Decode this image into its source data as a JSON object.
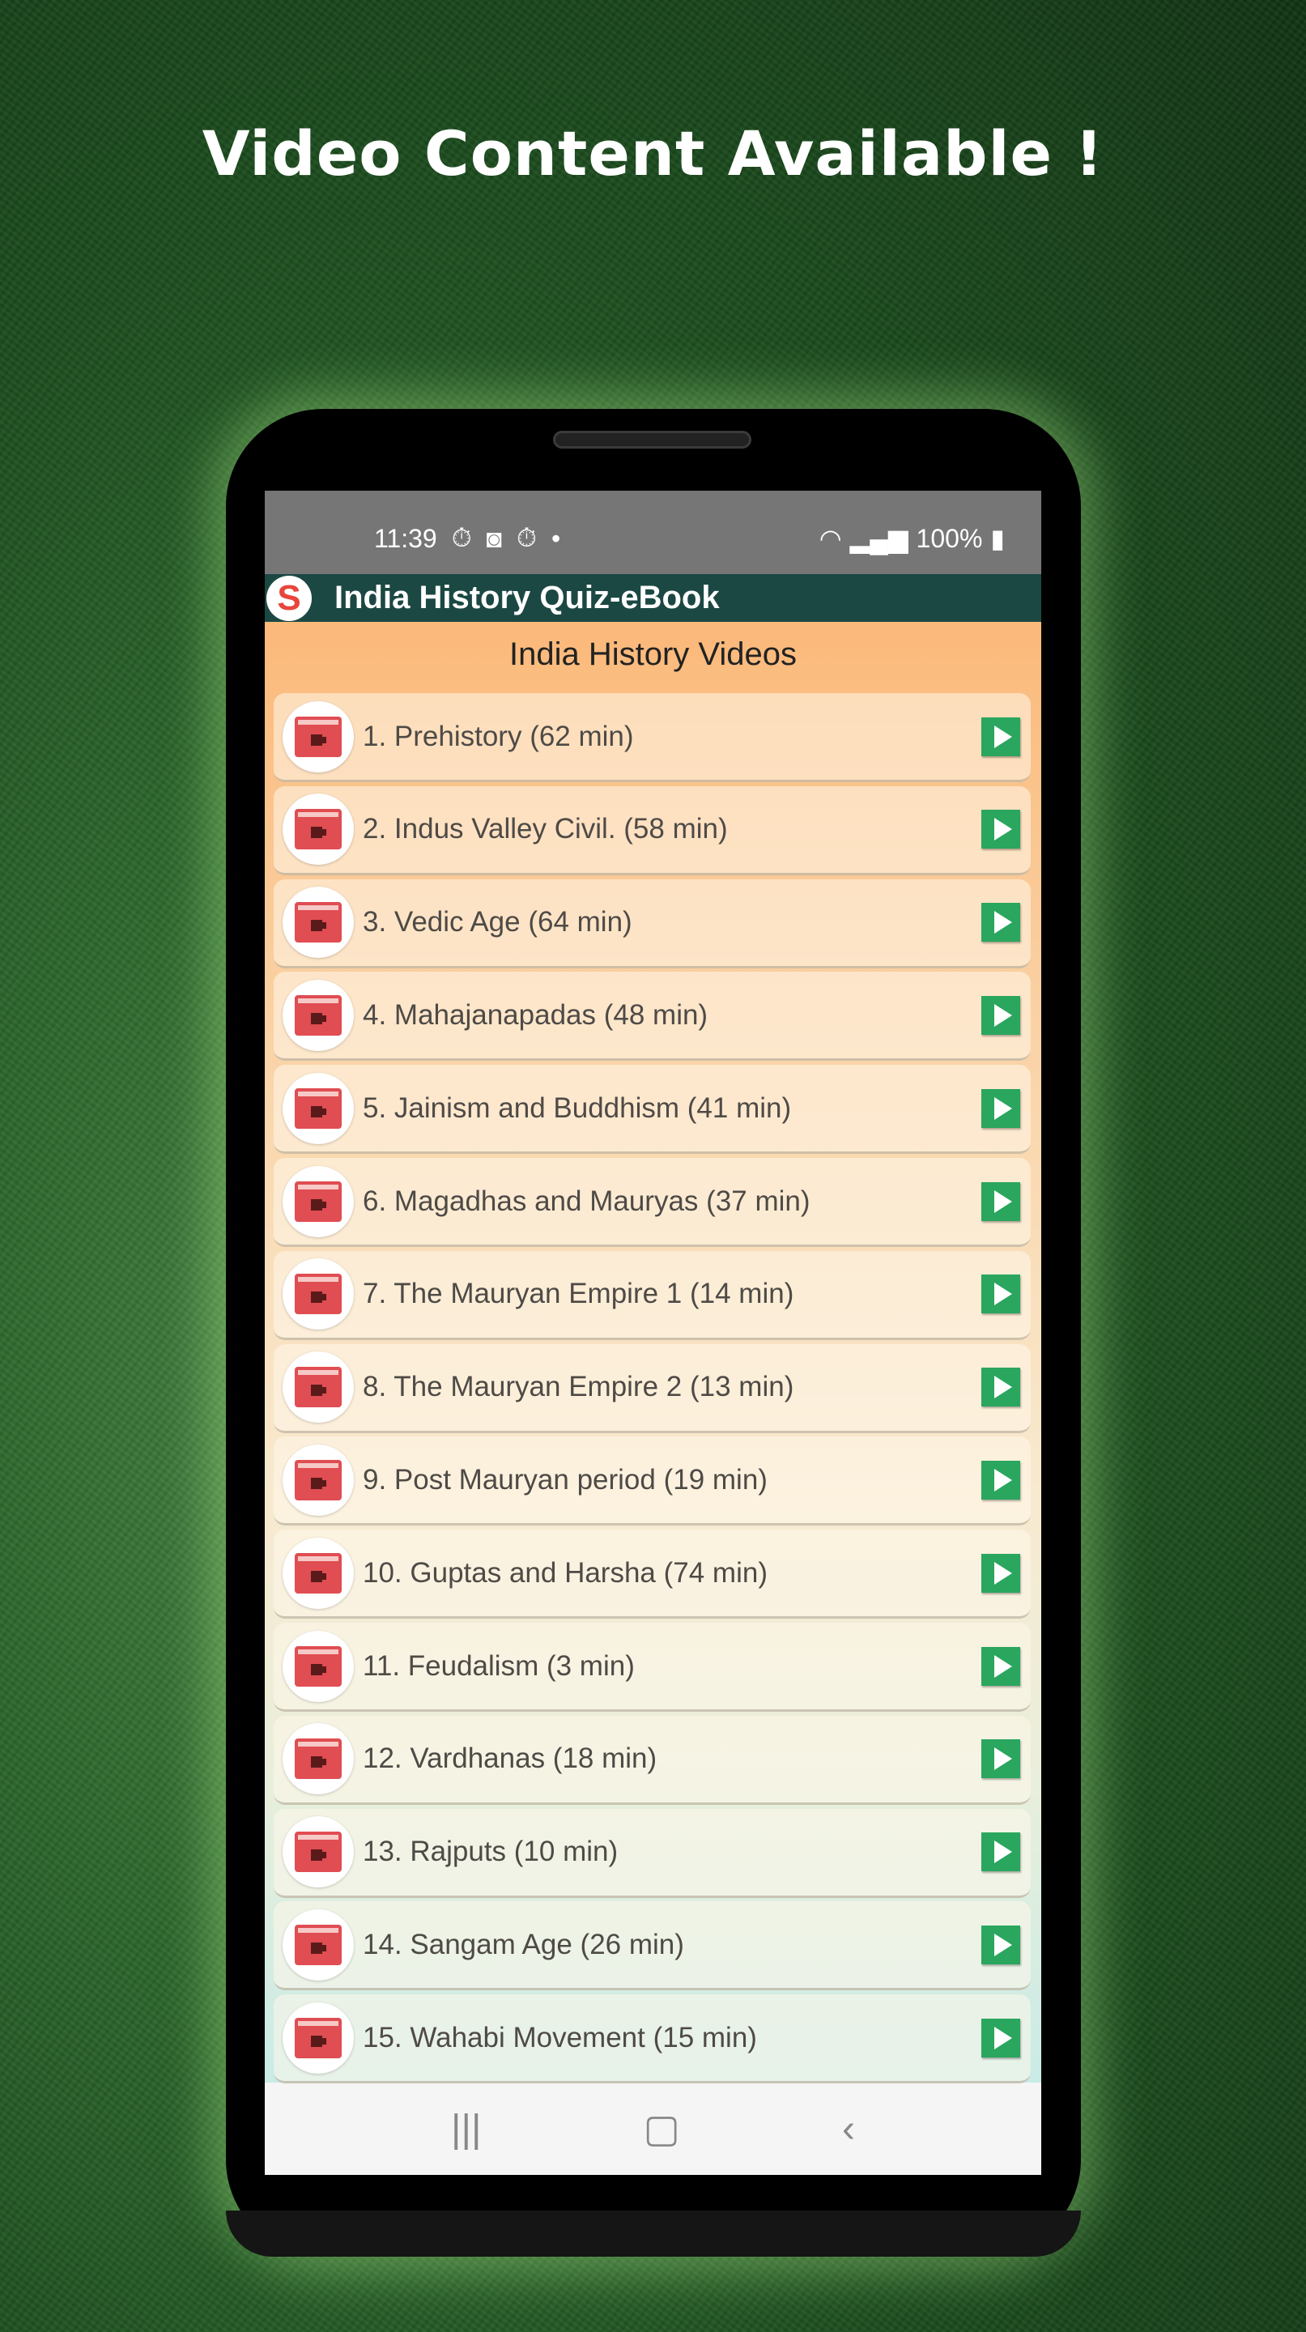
{
  "headline": "Video Content Available !",
  "status": {
    "time": "11:39",
    "battery": "100%"
  },
  "app": {
    "title": "India History Quiz-eBook"
  },
  "page_title": "India History Videos",
  "videos": [
    "1. Prehistory  (62 min)",
    "2. Indus Valley Civil. (58 min)",
    "3. Vedic Age (64 min)",
    "4. Mahajanapadas (48 min)",
    "5. Jainism and Buddhism (41 min)",
    "6. Magadhas and Mauryas (37 min)",
    "7. The Mauryan Empire 1 (14 min)",
    "8. The Mauryan Empire 2 (13 min)",
    "9. Post Mauryan period (19 min)",
    "10. Guptas and Harsha (74 min)",
    "11. Feudalism (3 min)",
    "12. Vardhanas (18 min)",
    "13. Rajputs (10 min)",
    "14. Sangam Age (26 min)",
    "15. Wahabi Movement (15 min)"
  ],
  "icons": {
    "row": "video-folder-icon",
    "action": "play-icon"
  },
  "colors": {
    "app_bar": "#1c4843",
    "play": "#2aa65e",
    "folder": "#e04d52"
  }
}
